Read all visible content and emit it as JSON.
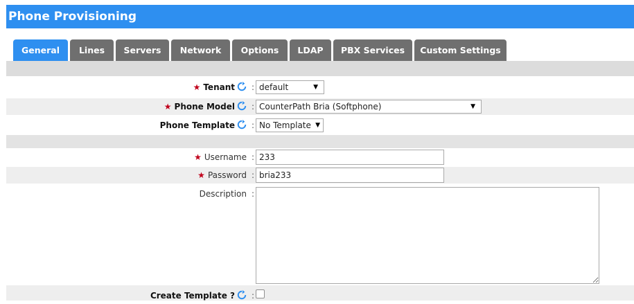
{
  "page": {
    "title": "Phone Provisioning"
  },
  "tabs": [
    {
      "label": "General",
      "active": true
    },
    {
      "label": "Lines"
    },
    {
      "label": "Servers"
    },
    {
      "label": "Network"
    },
    {
      "label": "Options"
    },
    {
      "label": "LDAP"
    },
    {
      "label": "PBX Services"
    },
    {
      "label": "Custom Settings"
    }
  ],
  "form": {
    "required_mark": "★",
    "colon": ":",
    "tenant": {
      "label": "Tenant",
      "value": "default"
    },
    "phone_model": {
      "label": "Phone Model",
      "value": "CounterPath Bria (Softphone)"
    },
    "phone_template": {
      "label": "Phone Template",
      "value": "No Template"
    },
    "username": {
      "label": "Username",
      "value": "233"
    },
    "password": {
      "label": "Password",
      "value": "bria233"
    },
    "description": {
      "label": "Description",
      "value": ""
    },
    "create_template": {
      "label": "Create Template ?",
      "checked": false
    }
  },
  "colors": {
    "accent": "#2e8ff0",
    "tab_inactive": "#6f6f6f",
    "required": "#c0001b",
    "refresh_icon": "#2e8ff0"
  },
  "icons": {
    "refresh": "refresh-icon",
    "dropdown": "chevron-down-icon"
  }
}
